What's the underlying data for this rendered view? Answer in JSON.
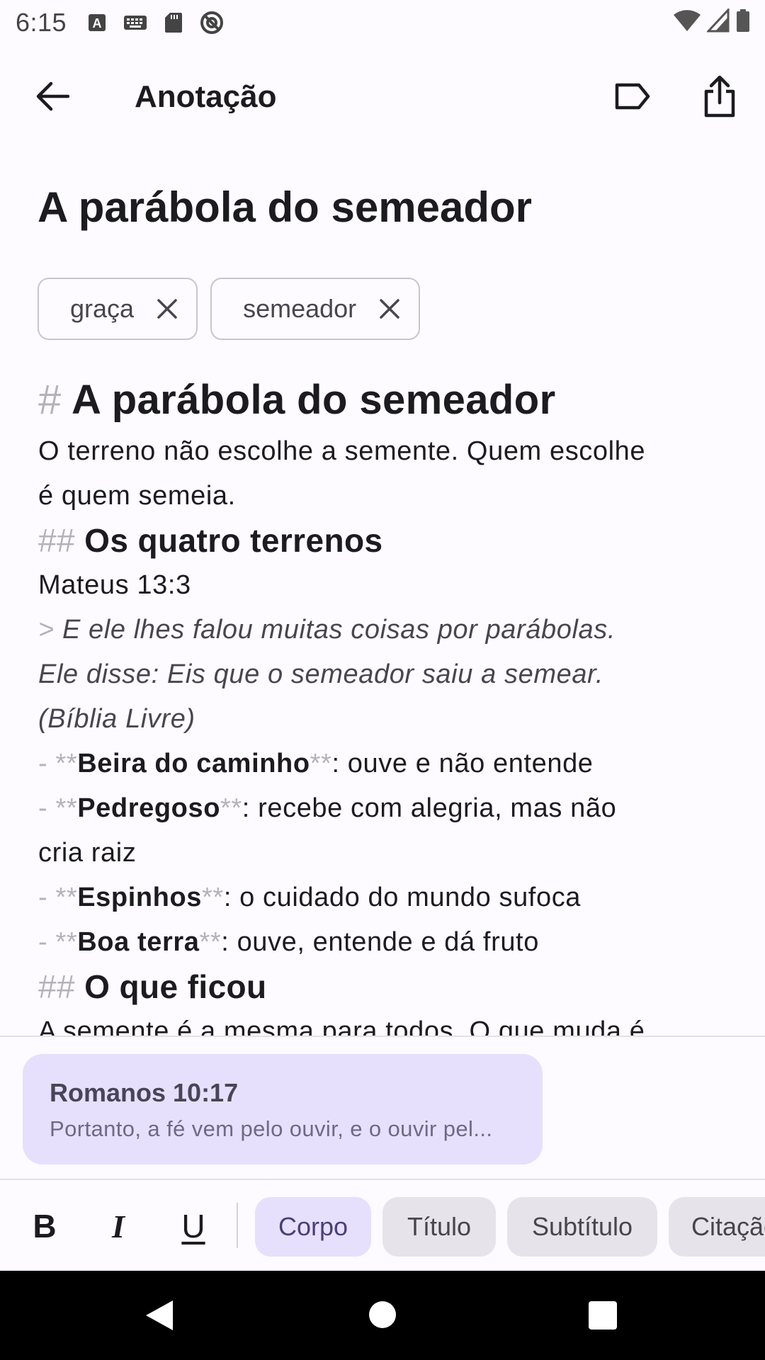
{
  "status": {
    "time": "6:15"
  },
  "app_bar": {
    "title": "Anotação"
  },
  "note": {
    "title": "A parábola do semeador",
    "tags": [
      {
        "label": "graça"
      },
      {
        "label": "semeador"
      }
    ]
  },
  "editor": {
    "h1_mark": "#",
    "h1_text": "A parábola do semeador",
    "p1_line1": "O terreno não escolhe a semente. Quem escolhe",
    "p1_line2": "é quem semeia.",
    "h2_mark": "##",
    "h2a_text": "Os quatro terrenos",
    "ref": "Mateus 13:3",
    "quote_mark": ">",
    "quote_line1": " E ele lhes falou muitas coisas por parábolas.",
    "quote_line2": "Ele disse: Eis que o semeador saiu a semear.",
    "quote_line3": "(Bíblia Livre)",
    "list_mark": "-",
    "bold_mark": "**",
    "items": [
      {
        "term": "Beira do caminho",
        "desc": ": ouve e não entende",
        "cont": ""
      },
      {
        "term": "Pedregoso",
        "desc": ": recebe com alegria, mas não",
        "cont": "cria raiz"
      },
      {
        "term": "Espinhos",
        "desc": ": o cuidado do mundo sufoca",
        "cont": ""
      },
      {
        "term": "Boa terra",
        "desc": ": ouve, entende e dá fruto",
        "cont": ""
      }
    ],
    "h2b_text": "O que ficou",
    "p2_line1": "A semente é a mesma para todos. O que muda é"
  },
  "verse_card": {
    "reference": "Romanos 10:17",
    "text": "Portanto, a fé vem pelo ouvir, e o ouvir pel..."
  },
  "toolbar": {
    "bold": "B",
    "italic": "I",
    "underline": "U",
    "chips": [
      "Corpo",
      "Título",
      "Subtítulo",
      "Citação"
    ],
    "active_chip": "Corpo"
  },
  "colors": {
    "accent_container": "#e6e0fc",
    "markdown_syntax": "#b5b1ba",
    "chip_bg": "#e7e3ea"
  }
}
